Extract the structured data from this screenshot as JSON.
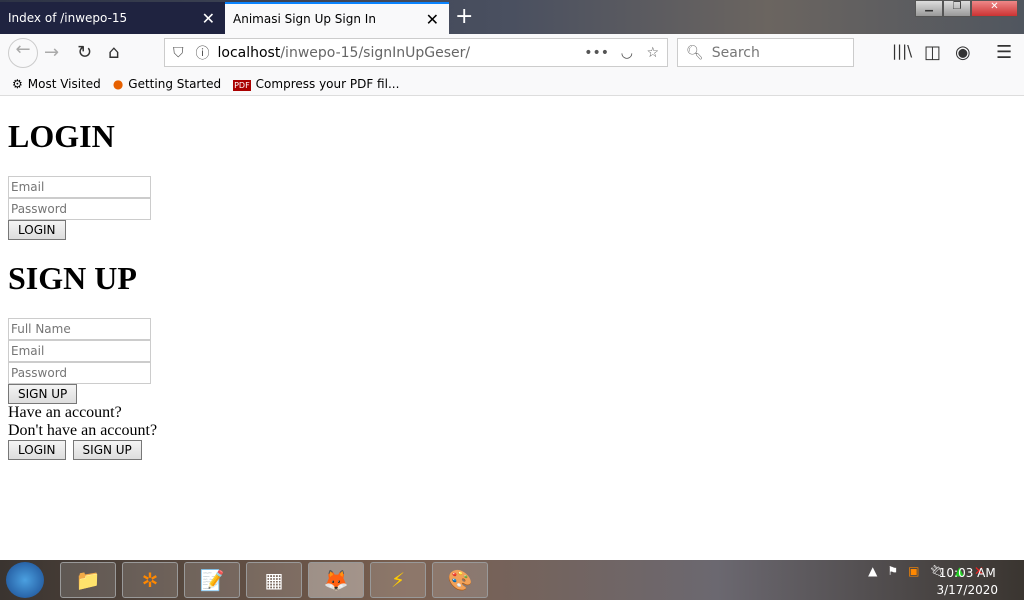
{
  "browser": {
    "tabs": [
      {
        "title": "Index of /inwepo-15"
      },
      {
        "title": "Animasi Sign Up Sign In"
      }
    ],
    "url_host": "localhost",
    "url_path": "/inwepo-15/signInUpGeser/",
    "search_placeholder": "Search",
    "bookmarks": [
      "Most Visited",
      "Getting Started",
      "Compress your PDF fil..."
    ]
  },
  "page": {
    "login_title": "LOGIN",
    "login_email_ph": "Email",
    "login_password_ph": "Password",
    "login_button": "LOGIN",
    "signup_title": "SIGN UP",
    "signup_name_ph": "Full Name",
    "signup_email_ph": "Email",
    "signup_password_ph": "Password",
    "signup_button": "SIGN UP",
    "have_account": "Have an account?",
    "no_account": "Don't have an account?",
    "switch_login": "LOGIN",
    "switch_signup": "SIGN UP"
  },
  "taskbar": {
    "time": "10:03 AM",
    "date": "3/17/2020"
  }
}
